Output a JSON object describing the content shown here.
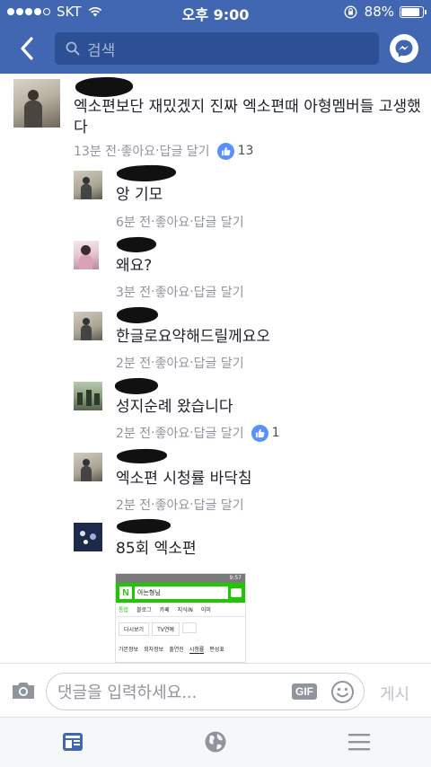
{
  "status_bar": {
    "carrier": "SKT",
    "time": "오후 9:00",
    "battery_percent": "88%",
    "battery_level": 0.88
  },
  "header": {
    "search_placeholder": "검색",
    "icons": [
      "back-arrow-icon",
      "search-icon",
      "messenger-icon"
    ],
    "accent_color": "#4267b2"
  },
  "comments": [
    {
      "text": "엑소편보단 재밌겠지 진짜 엑소편때 아형멤버들 고생했다",
      "time": "13분 전",
      "like": "좋아요",
      "reply": "답글 달기",
      "likes": "13"
    },
    {
      "text": "앙 기모",
      "time": "6분 전",
      "like": "좋아요",
      "reply": "답글 달기"
    },
    {
      "text": "왜요?",
      "time": "3분 전",
      "like": "좋아요",
      "reply": "답글 달기"
    },
    {
      "text": "한글로요약해드릴께요오",
      "time": "2분 전",
      "like": "좋아요",
      "reply": "답글 달기"
    },
    {
      "text": "성지순례 왔습니다",
      "time": "2분 전",
      "like": "좋아요",
      "reply": "답글 달기",
      "likes": "1"
    },
    {
      "text": "엑소편 시청률 바닥침",
      "time": "2분 전",
      "like": "좋아요",
      "reply": "답글 달기"
    },
    {
      "text": "85회 엑소편"
    }
  ],
  "separator": " · ",
  "preview": {
    "clock": "9:57",
    "query": "아는형님",
    "tabs": [
      "통합",
      "블로그",
      "카페",
      "지식iN",
      "이미"
    ],
    "buttons": [
      "다시보기",
      "TV연예"
    ],
    "info_tabs": [
      "기본정보",
      "회차정보",
      "출연진",
      "시청률",
      "편성표"
    ]
  },
  "composer": {
    "placeholder": "댓글을 입력하세요...",
    "gif_label": "GIF",
    "post_label": "게시"
  },
  "tabbar": {
    "icons": [
      "news-feed-icon",
      "globe-icon",
      "menu-icon"
    ]
  }
}
